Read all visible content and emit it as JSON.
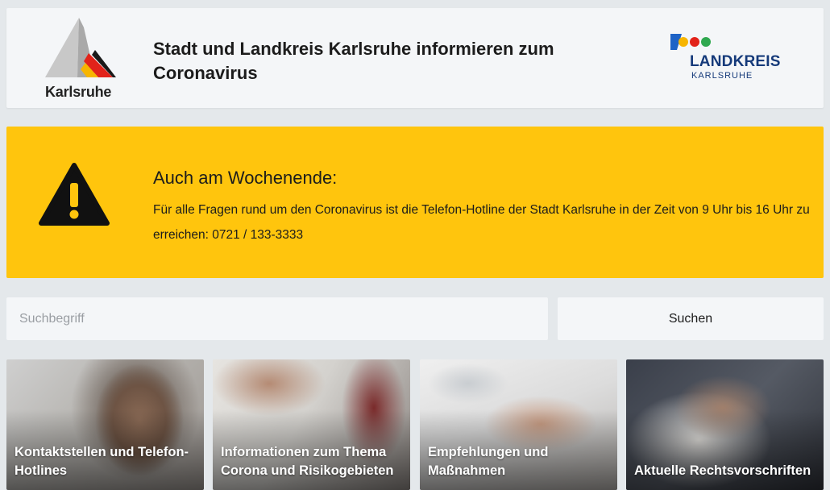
{
  "header": {
    "logo_left_text": "Karlsruhe",
    "title": "Stadt und Landkreis Karlsruhe informieren zum Coronavirus",
    "logo_right_line1": "LANDKREIS",
    "logo_right_line2": "KARLSRUHE"
  },
  "alert": {
    "icon": "warning-icon",
    "title": "Auch am Wochenende:",
    "text": "Für alle Fragen rund um den Coronavirus ist die Telefon-Hotline der Stadt Karlsruhe in der Zeit von 9 Uhr bis 16 Uhr zu erreichen: 0721 / 133-3333",
    "background": "#ffc50d"
  },
  "search": {
    "placeholder": "Suchbegriff",
    "value": "",
    "button_label": "Suchen"
  },
  "tiles": [
    {
      "label": "Kontaktstellen und Telefon-Hotlines"
    },
    {
      "label": "Informationen zum Thema Corona und Risikogebieten"
    },
    {
      "label": "Empfehlungen und Maßnahmen"
    },
    {
      "label": "Aktuelle Rechtsvorschriften"
    }
  ],
  "colors": {
    "page_background": "#e4e8eb",
    "panel_background": "#f4f6f8",
    "landkreis_blue": "#153a7a"
  }
}
